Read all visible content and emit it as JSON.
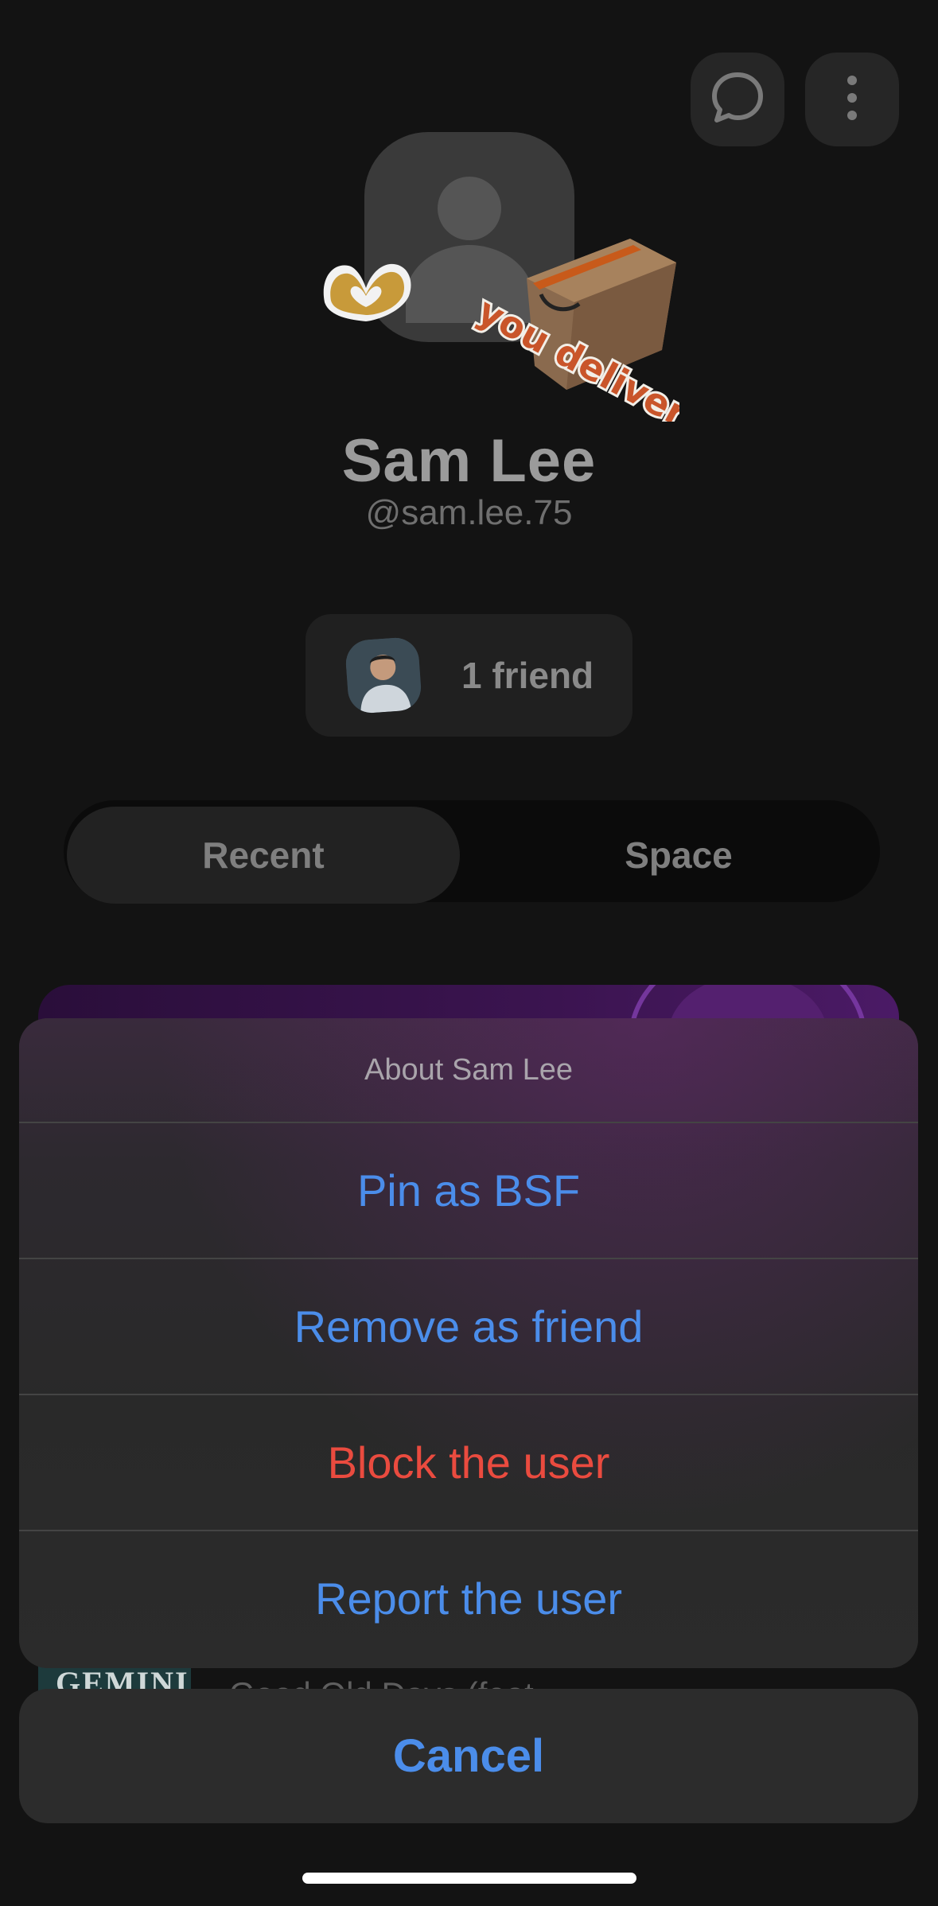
{
  "profile": {
    "name": "Sam Lee",
    "handle": "@sam.lee.75",
    "friends_label": "1 friend",
    "sticker_text": "you delivered",
    "sticker_brand": "amazon"
  },
  "tabs": [
    {
      "label": "Recent",
      "selected": true
    },
    {
      "label": "Space",
      "selected": false
    }
  ],
  "feed": {
    "thumb_text": "GEMINI",
    "title_partial": "Good Old Days (feat..."
  },
  "action_sheet": {
    "title": "About Sam Lee",
    "items": [
      {
        "label": "Pin as BSF",
        "style": "default"
      },
      {
        "label": "Remove as friend",
        "style": "default"
      },
      {
        "label": "Block the user",
        "style": "destructive"
      },
      {
        "label": "Report the user",
        "style": "default"
      }
    ],
    "cancel_label": "Cancel"
  },
  "colors": {
    "action_blue": "#4b8dea",
    "destructive_red": "#ea4b3f",
    "sheet_bg": "#2b2b2b"
  },
  "icons": {
    "chat": "chat-bubble-icon",
    "more": "vertical-ellipsis-icon"
  }
}
